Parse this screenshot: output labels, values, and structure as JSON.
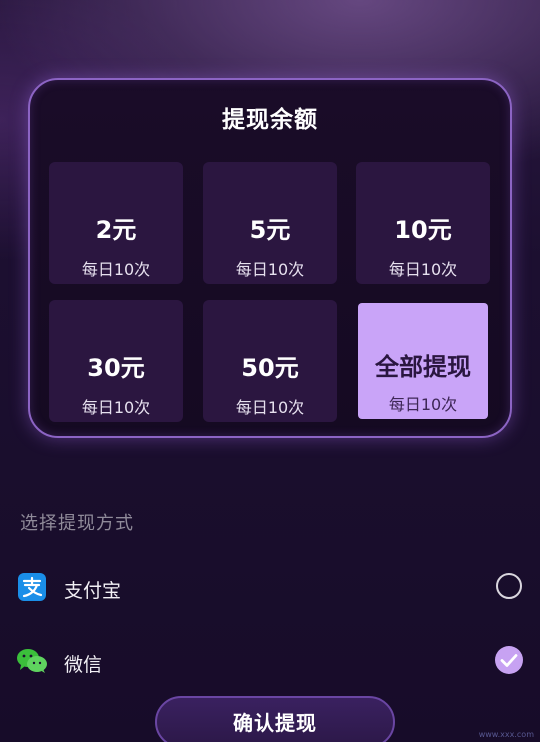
{
  "withdraw": {
    "title": "提现余额",
    "options": [
      {
        "amount": "2元",
        "limit": "每日10次"
      },
      {
        "amount": "5元",
        "limit": "每日10次"
      },
      {
        "amount": "10元",
        "limit": "每日10次"
      },
      {
        "amount": "30元",
        "limit": "每日10次"
      },
      {
        "amount": "50元",
        "limit": "每日10次"
      },
      {
        "amount": "全部提现",
        "limit": "每日10次"
      }
    ],
    "selected_index": 5
  },
  "payment": {
    "label": "选择提现方式",
    "methods": [
      {
        "name": "支付宝",
        "icon": "alipay-icon",
        "checked": false
      },
      {
        "name": "微信",
        "icon": "wechat-icon",
        "checked": true
      }
    ]
  },
  "confirm": {
    "label": "确认提现"
  },
  "watermark": "www.xxx.com",
  "colors": {
    "accent": "#c9a4f8",
    "panel_border": "#8c64c4",
    "background": "#1c0f30",
    "alipay_blue": "#1a8ee8",
    "wechat_green": "#3bbf3b"
  }
}
